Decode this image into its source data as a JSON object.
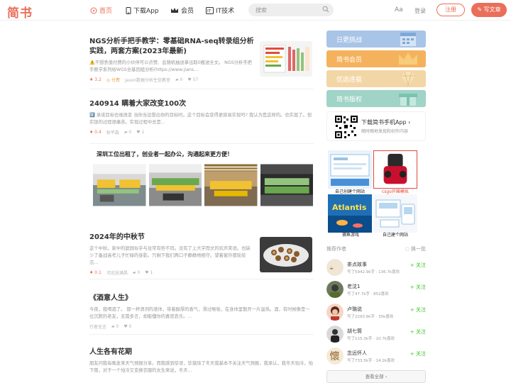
{
  "nav": {
    "logo": "简书",
    "home": "首页",
    "download": "下载App",
    "member": "会员",
    "it": "IT技术",
    "search_placeholder": "搜索",
    "font_toggle": "Aa",
    "login": "登录",
    "signup": "注册",
    "write": "写文章"
  },
  "colors": {
    "brand": "#ea6f5a",
    "follow": "#42c02e"
  },
  "articles": [
    {
      "title": "NGS分析手把手教学：零基础RNA-seq转录组分析实践，两套方案(2023年最新)",
      "desc": "⚠️不想丢值付费的小伙伴可以点赞、会随机抽送拿出取0搬送全文。 NGS分析手把手教学系列给WGS全基因组分析(https://www.jians...",
      "diamond": "3.2",
      "paid": "付费",
      "author": "Jason数据分析生信教室",
      "comments": "0",
      "likes": "57"
    },
    {
      "title": "240914 瞒着大家改变100次",
      "desc": "0️⃣ 承诺目标也维改变 当你当设想出你的目标时。这个目标会变得更容易实现吗? 我认为是这样的。也实届了。但实现的过程很痛苦。实现过程中总是...",
      "diamond": "0.4",
      "author": "秋平森",
      "comments": "0",
      "likes": "1"
    },
    {
      "title": "2024年的中秋节",
      "desc": "这个中秋。家中的庭园似乎与往常有些不同。没有了上大学而文的欢声笑语。也缺少了备战高考儿子忙碌的身影。只剩下我们两口子静静地相守。望着窗外那轮皎洁...",
      "diamond": "0.1",
      "author": "河北张满昌",
      "comments": "0",
      "likes": "1"
    },
    {
      "title": "《酒意人生》",
      "desc": "今夜，我喝酒了。 那一杯清冽的液体，带着醇厚的香气，滑过喉咙，在身体里散开一片温热。酒，有时候像是一位沉默的老友，无需多言，却能懂你的喜怒哀乐。...",
      "author": "行者无言",
      "comments": "0",
      "likes": "0"
    },
    {
      "title": "人生各有花期",
      "desc": "朋友问我每晚发来天气预报分享。而我感到惊讶，毕竟除了冬天我基本不关注天气预报，我承认，我冬天怕冷，怕下雨，对于一个怕冷又变换衣服的女生来说，冬天..."
    }
  ],
  "banner_text": "深圳工位出租了，创业者一起办公，沟通起来更方便！",
  "sidebar": {
    "buttons": [
      "日更挑战",
      "简书会员",
      "优选连载",
      "简书版权"
    ],
    "app_title": "下载简书手机App",
    "app_sub": "随时随地发现和创作内容",
    "ads": [
      "自己创建个网站",
      "csgo开箱模拟",
      "捕鱼游戏",
      "自己建个网站"
    ],
    "recommend_label": "推荐作者",
    "refresh": "换一批",
    "follow": "+ 关注",
    "authors": [
      {
        "name": "茶点故事",
        "stats": "写了5942.9k字 · 136.7k喜欢"
      },
      {
        "name": "老沈1",
        "stats": "写了47.7k字 · 852喜欢"
      },
      {
        "name": "卢璐说",
        "stats": "写了2293.9k字 · 35k喜欢"
      },
      {
        "name": "胡七筒",
        "stats": "写了115.3k字 · 10.7k喜欢"
      },
      {
        "name": "念远怀人",
        "stats": "写了733.5k字 · 14.2k喜欢"
      }
    ],
    "view_all": "查看全部 ›"
  }
}
